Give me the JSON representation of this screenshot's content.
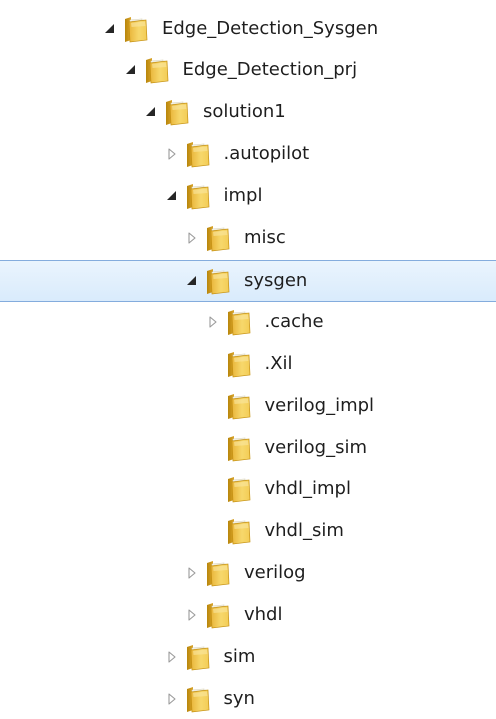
{
  "colors": {
    "selection_fill": "#dcecfc",
    "selection_border": "#84acdd",
    "folder_yellow": "#f2c94c",
    "folder_dark": "#c69214",
    "expander_filled": "#262626",
    "expander_hollow": "#9a9a9a"
  },
  "tree": {
    "nodes": [
      {
        "label": "Edge_Detection_Sysgen",
        "depth": 0,
        "state": "expanded",
        "selected": false,
        "icon": "folder-icon"
      },
      {
        "label": "Edge_Detection_prj",
        "depth": 1,
        "state": "expanded",
        "selected": false,
        "icon": "folder-icon"
      },
      {
        "label": "solution1",
        "depth": 2,
        "state": "expanded",
        "selected": false,
        "icon": "folder-icon"
      },
      {
        "label": ".autopilot",
        "depth": 3,
        "state": "collapsed",
        "selected": false,
        "icon": "folder-icon"
      },
      {
        "label": "impl",
        "depth": 3,
        "state": "expanded",
        "selected": false,
        "icon": "folder-icon"
      },
      {
        "label": "misc",
        "depth": 4,
        "state": "collapsed",
        "selected": false,
        "icon": "folder-icon"
      },
      {
        "label": "sysgen",
        "depth": 4,
        "state": "expanded",
        "selected": true,
        "icon": "folder-icon"
      },
      {
        "label": ".cache",
        "depth": 5,
        "state": "collapsed",
        "selected": false,
        "icon": "folder-icon"
      },
      {
        "label": ".Xil",
        "depth": 5,
        "state": "leaf",
        "selected": false,
        "icon": "folder-icon"
      },
      {
        "label": "verilog_impl",
        "depth": 5,
        "state": "leaf",
        "selected": false,
        "icon": "folder-icon"
      },
      {
        "label": "verilog_sim",
        "depth": 5,
        "state": "leaf",
        "selected": false,
        "icon": "folder-icon"
      },
      {
        "label": "vhdl_impl",
        "depth": 5,
        "state": "leaf",
        "selected": false,
        "icon": "folder-icon"
      },
      {
        "label": "vhdl_sim",
        "depth": 5,
        "state": "leaf",
        "selected": false,
        "icon": "folder-icon"
      },
      {
        "label": "verilog",
        "depth": 4,
        "state": "collapsed",
        "selected": false,
        "icon": "folder-icon"
      },
      {
        "label": "vhdl",
        "depth": 4,
        "state": "collapsed",
        "selected": false,
        "icon": "folder-icon"
      },
      {
        "label": "sim",
        "depth": 3,
        "state": "collapsed",
        "selected": false,
        "icon": "folder-icon"
      },
      {
        "label": "syn",
        "depth": 3,
        "state": "collapsed",
        "selected": false,
        "icon": "folder-icon"
      }
    ]
  }
}
